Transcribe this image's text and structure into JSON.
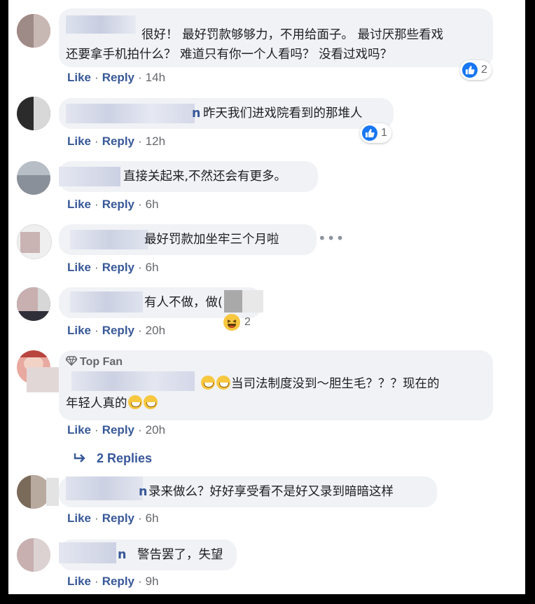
{
  "actions": {
    "like": "Like",
    "reply": "Reply",
    "sep": "·"
  },
  "comments": [
    {
      "text_lines": [
        "很好！ 最好罚款够够力，不用给面子。 最讨厌那些看戏",
        "还要拿手机拍什么？ 难道只有你一个人看吗？ 没看过戏吗？"
      ],
      "time": "14h",
      "reaction_count": "2"
    },
    {
      "text_lines": [
        "昨天我们进戏院看到的那堆人"
      ],
      "name_fragment": "n",
      "time": "12h",
      "reaction_count": "1"
    },
    {
      "text_lines": [
        "直接关起来,不然还会有更多。"
      ],
      "time": "6h"
    },
    {
      "text_lines": [
        "最好罚款加坐牢三个月啦"
      ],
      "time": "6h"
    },
    {
      "text_lines": [
        "有人不做，做("
      ],
      "time": "20h",
      "reaction_count": "2"
    },
    {
      "badge": "Top Fan",
      "text_lines": [
        "当司法制度没到～胆生毛？？？现在的",
        "年轻人真的"
      ],
      "time": "20h"
    },
    {
      "text_lines": [
        "录来做么？好好享受看不是好又录到暗暗这样"
      ],
      "name_fragment": "n",
      "time": "6h"
    },
    {
      "text_lines": [
        "警告罢了，失望"
      ],
      "name_fragment": "n",
      "time": "9h"
    }
  ],
  "replies_link": "2 Replies",
  "icons": {
    "like": "like-icon",
    "haha": "haha-icon",
    "diamond": "diamond-icon",
    "reply_arrow": "reply-arrow-icon",
    "more": "more-icon"
  },
  "colors": {
    "link": "#385898",
    "bubble": "#f0f2f5",
    "like_blue": "#1877f2"
  }
}
